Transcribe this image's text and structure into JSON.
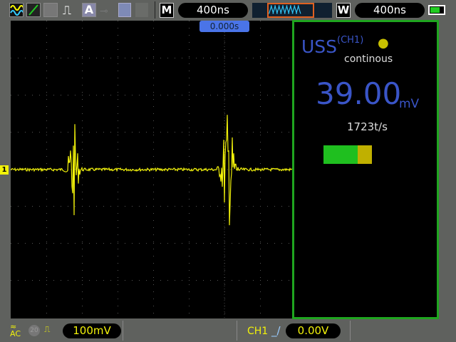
{
  "toolbar": {
    "icons": [
      "channel-wave-icon",
      "cursor-line-icon",
      "persist-icon",
      "pulse-icon",
      "auto-icon",
      "probe-icon",
      "save-icon",
      "print-icon"
    ],
    "auto_label": "A",
    "menu_label": "M",
    "timebase": "400ns",
    "window_label": "W",
    "window_timebase": "400ns"
  },
  "trigger_position": "0.000s",
  "channel_marker": "1",
  "panel": {
    "title": "USS",
    "channel": "(CH1)",
    "mode": "continous",
    "value": "39.00",
    "unit": "mV",
    "rate": "1723t/s",
    "level_fraction": 0.7
  },
  "bottom": {
    "coupling": "AC",
    "bw_limit": "20",
    "volts_div": "100mV",
    "trigger_source": "CH1",
    "trigger_level": "0.00V"
  },
  "colors": {
    "ch1": "#f2f20a",
    "accent": "#3a55c8",
    "panel_border": "#1fa51f"
  }
}
